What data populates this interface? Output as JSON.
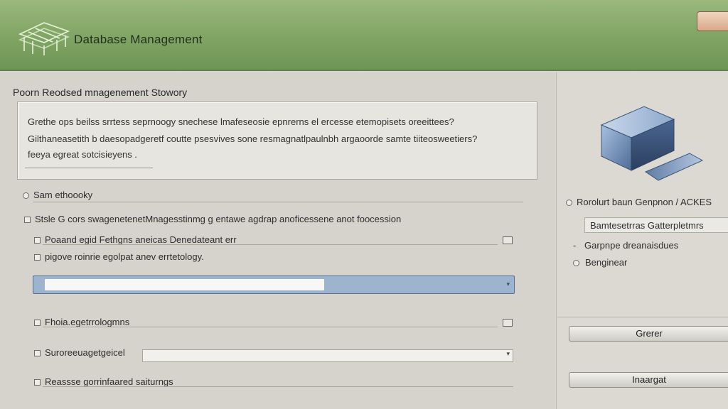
{
  "header": {
    "title": "Database Management",
    "logo_icon": "building-structure-icon",
    "top_button_label": ""
  },
  "main": {
    "section_title": "Poorn Reodsed mnagenement Stowory",
    "description": {
      "lines": [
        "Grethe ops beilss srrtess seprnoogy snechese lmafeseosie epnrerns el ercesse etemopisets oreeittees?",
        "Gilthaneasetith b daesopadgeretf coutte psesvives sone resmagnatlpaulnbh argaoorde samte tiiteosweetiers?",
        "feeya egreat sotcisieyens ."
      ]
    },
    "radio_row": {
      "label": "Sam ethoooky",
      "icon": "radio-icon"
    },
    "group_row": {
      "label": "Stsle G cors swagenetenetMnagesstinmg g entawe agdrap anoficessene anot foocession",
      "icon": "checkbox-icon"
    },
    "option_rows": [
      {
        "label": "Poaand egid Fethgns aneicas Denedateant err",
        "checked": false
      },
      {
        "label": "pigove roinrie egolpat anev errtetology.",
        "checked": false
      }
    ],
    "progress": {
      "fraction": 0.61,
      "caret": "▾"
    },
    "field_rows": [
      {
        "label": "Fhoia.egetrrologmns",
        "checked": false
      },
      {
        "label": "Suroreeuagetgeicel",
        "checked": false,
        "caret": "▾"
      },
      {
        "label": "Reassse gorrinfaared saiturngs",
        "checked": false
      }
    ]
  },
  "side": {
    "graphic_icon": "database-cube-icon",
    "radio_label": "Rorolurt baun Genpnon / ACKES",
    "input_value": "Bamtesetrras Gatterpletmrs",
    "options": [
      {
        "label": "Garpnpe dreanaisdues",
        "icon": "dash-icon"
      },
      {
        "label": "Benginear",
        "icon": "radio-icon"
      }
    ],
    "button_1": "Grerer",
    "button_2": "Inaargat"
  },
  "colors": {
    "header_green": "#7fa463",
    "progress_blue": "#9db4cf",
    "cube_blue": "#6f8fb8",
    "panel_bg": "#d6d3cc"
  }
}
